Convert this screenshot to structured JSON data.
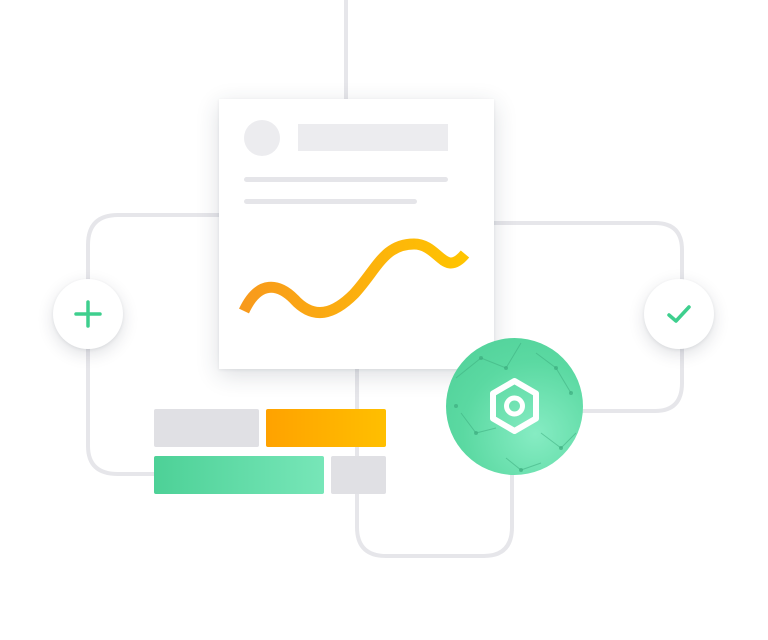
{
  "illustration": {
    "card": {
      "avatar": "avatar-placeholder",
      "title": "title-placeholder",
      "text_lines": 2,
      "trend_line": {
        "type": "line",
        "colors": [
          "#f89a1c",
          "#ffc400"
        ]
      }
    },
    "buttons": [
      {
        "icon": "plus-icon",
        "color": "#3ecf8e"
      },
      {
        "icon": "check-icon",
        "color": "#3ecf8e"
      }
    ],
    "hub": {
      "icon": "hexagon-gear-icon",
      "color": "#5bd9a2"
    },
    "bars": [
      {
        "color": "#e0e0e4"
      },
      {
        "color": "#ffae00"
      },
      {
        "color": "#5bd9a2"
      },
      {
        "color": "#e0e0e4"
      }
    ],
    "colors": {
      "connector": "#e6e6ea",
      "card": "#ffffff",
      "placeholder": "#ececef",
      "accent_green": "#3ecf8e",
      "accent_orange": "#ffae00"
    }
  }
}
